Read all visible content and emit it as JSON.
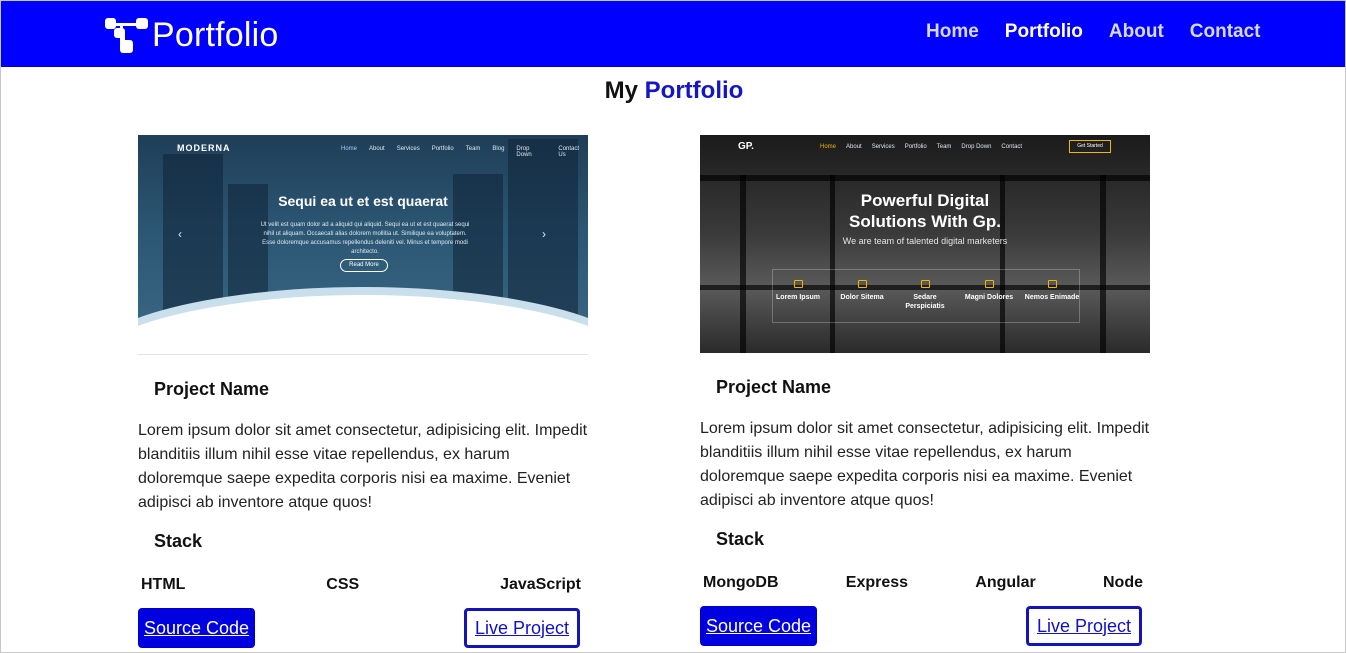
{
  "navbar": {
    "brand": "Portfolio",
    "links": [
      "Home",
      "Portfolio",
      "About",
      "Contact"
    ],
    "active_link": "Portfolio"
  },
  "heading": {
    "prefix": "My",
    "accent": "Portfolio"
  },
  "projects": [
    {
      "preview": {
        "brand": "MODERNA",
        "menu": [
          "Home",
          "About",
          "Services",
          "Portfolio",
          "Team",
          "Blog",
          "Drop Down",
          "Contact Us"
        ],
        "hero_title": "Sequi ea ut et est quaerat",
        "hero_text": "Ut velit est quam dolor ad a aliquid qui aliquid. Sequi ea ut et est quaerat sequi nihil ut aliquam. Occaecati alias dolorem mollitia ut. Similique ea voluptatem. Esse doloremque accusamus repellendus deleniti vel. Minus et tempore modi architecto.",
        "button": "Read More"
      },
      "name": "Project Name",
      "description": "Lorem ipsum dolor sit amet consectetur, adipisicing elit. Impedit blanditiis illum nihil esse vitae repellendus, ex harum doloremque saepe expedita corporis nisi ea maxime. Eveniet adipisci ab inventore atque quos!",
      "stack_label": "Stack",
      "stack": [
        "HTML",
        "CSS",
        "JavaScript"
      ],
      "source_label": "Source Code",
      "live_label": "Live Project"
    },
    {
      "preview": {
        "brand": "GP.",
        "menu": [
          "Home",
          "About",
          "Services",
          "Portfolio",
          "Team",
          "Drop Down",
          "Contact"
        ],
        "cta": "Get Started",
        "hero_line1": "Powerful Digital",
        "hero_line2": "Solutions With Gp.",
        "hero_sub": "We are team of talented digital marketers",
        "features": [
          "Lorem Ipsum",
          "Dolor Sitema",
          "Sedare Perspiciatis",
          "Magni Dolores",
          "Nemos Enimade"
        ]
      },
      "name": "Project Name",
      "description": "Lorem ipsum dolor sit amet consectetur, adipisicing elit. Impedit blanditiis illum nihil esse vitae repellendus, ex harum doloremque saepe expedita corporis nisi ea maxime. Eveniet adipisci ab inventore atque quos!",
      "stack_label": "Stack",
      "stack": [
        "MongoDB",
        "Express",
        "Angular",
        "Node"
      ],
      "source_label": "Source Code",
      "live_label": "Live Project"
    }
  ],
  "colors": {
    "navbar": "#0000ff",
    "accent": "#1515c8",
    "button": "#0000e0"
  }
}
